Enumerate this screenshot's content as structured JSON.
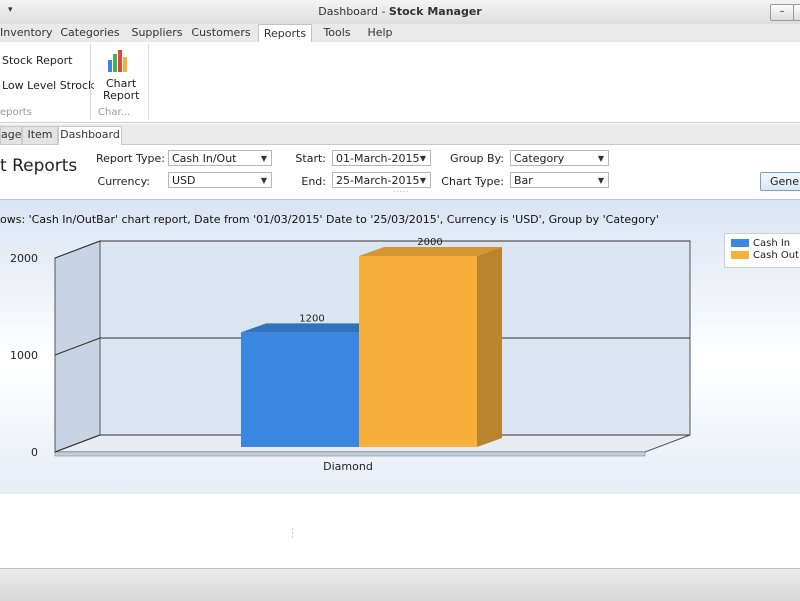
{
  "window": {
    "title_prefix": "Dashboard - ",
    "title_app": "Stock Manager",
    "quick_access": "▾",
    "minimize": "–",
    "restore": "▭"
  },
  "menu": {
    "tabs": [
      "Inventory",
      "Categories",
      "Suppliers",
      "Customers",
      "Reports",
      "Tools",
      "Help"
    ],
    "active": "Reports"
  },
  "ribbon": {
    "stock_report": "Stock Report",
    "low_level_stock": "Low Level Strock",
    "group1_label": "eports",
    "chart_report_line1": "Chart",
    "chart_report_line2": "Report",
    "group2_label": "Char..."
  },
  "page_tabs": {
    "tabs": [
      "age",
      "Item",
      "Dashboard"
    ],
    "active": "Dashboard"
  },
  "filters": {
    "heading": "t Reports",
    "report_type_label": "Report Type:",
    "report_type_value": "Cash In/Out",
    "currency_label": "Currency:",
    "currency_value": "USD",
    "start_label": "Start:",
    "start_value": "01-March-2015",
    "end_label": "End:",
    "end_value": "25-March-2015",
    "group_by_label": "Group By:",
    "group_by_value": "Category",
    "chart_type_label": "Chart Type:",
    "chart_type_value": "Bar",
    "generate_button": "Generate"
  },
  "caption": "ows: 'Cash In/OutBar' chart report, Date from '01/03/2015' Date to '25/03/2015', Currency is 'USD', Group by 'Category'",
  "chart_data": {
    "type": "bar",
    "categories": [
      "Diamond"
    ],
    "series": [
      {
        "name": "Cash In",
        "values": [
          1200
        ],
        "color": "#3a86e0"
      },
      {
        "name": "Cash Out",
        "values": [
          2000
        ],
        "color": "#f7b03c"
      }
    ],
    "yticks": [
      0,
      1000,
      2000
    ],
    "ylim": [
      0,
      2000
    ],
    "legend_position": "top-right",
    "grid": true
  }
}
